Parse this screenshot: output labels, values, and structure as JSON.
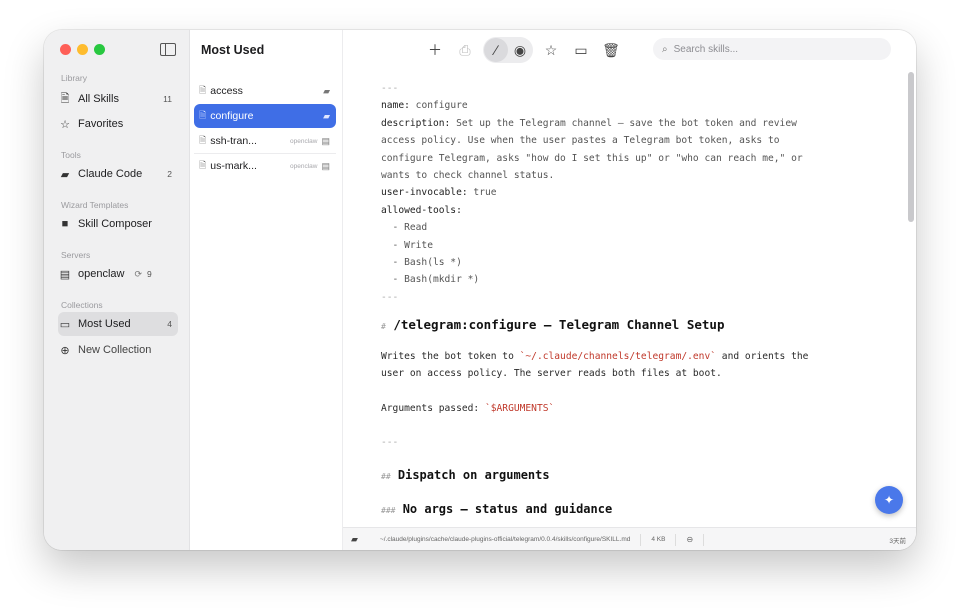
{
  "sidebar": {
    "sections": {
      "library": "Library",
      "tools": "Tools",
      "wizard": "Wizard Templates",
      "servers": "Servers",
      "collections": "Collections"
    },
    "items": {
      "all_skills": {
        "label": "All Skills",
        "count": "11",
        "icon": "document-icon"
      },
      "favorites": {
        "label": "Favorites",
        "icon": "star-icon"
      },
      "claude_code": {
        "label": "Claude Code",
        "count": "2",
        "icon": "robot-icon"
      },
      "skill_composer": {
        "label": "Skill Composer",
        "icon": "file-icon"
      },
      "openclaw": {
        "label": "openclaw",
        "count": "9",
        "icon": "server-icon"
      },
      "most_used": {
        "label": "Most Used",
        "count": "4",
        "icon": "folder-icon"
      },
      "new_collection": {
        "label": "New Collection",
        "icon": "plus-circle-icon"
      }
    }
  },
  "list": {
    "title": "Most Used",
    "rows": [
      {
        "name": "access",
        "tag": ""
      },
      {
        "name": "configure",
        "tag": ""
      },
      {
        "name": "ssh-tran...",
        "tag": "openclaw"
      },
      {
        "name": "us-mark...",
        "tag": "openclaw"
      }
    ]
  },
  "toolbar": {
    "search_placeholder": "Search skills..."
  },
  "doc": {
    "fm_sep": "---",
    "name_key": "name:",
    "name_val": " configure",
    "desc_key": "description:",
    "desc_lines": [
      " Set up the Telegram channel — save the bot token and review",
      "access policy. Use when the user pastes a Telegram bot token, asks to",
      "configure Telegram, asks \"how do I set this up\" or \"who can reach me,\" or",
      "wants to check channel status."
    ],
    "invocable_key": "user-invocable:",
    "invocable_val": " true",
    "tools_key": "allowed-tools:",
    "tools": [
      "  - Read",
      "  - Write",
      "  - Bash(ls *)",
      "  - Bash(mkdir *)"
    ],
    "h1_hash": "#",
    "h1": "/telegram:configure — Telegram Channel Setup",
    "p1_a": "Writes the bot token to ",
    "p1_code": "`~/.claude/channels/telegram/.env`",
    "p1_b": " and orients the",
    "p1_c": "user on access policy. The server reads both files at boot.",
    "args_label": "Arguments passed: ",
    "args_code": "`$ARGUMENTS`",
    "hr": "---",
    "h2_hash": "##",
    "h2": "Dispatch on arguments",
    "h3_hash": "###",
    "h3": "No args — status and guidance"
  },
  "status": {
    "path": "~/.claude/plugins/cache/claude-plugins-official/telegram/0.0.4/skills/configure/SKILL.md",
    "size": "4 KB",
    "time": "3天前"
  },
  "colors": {
    "accent": "#3f6ee6",
    "code": "#c0392b"
  }
}
